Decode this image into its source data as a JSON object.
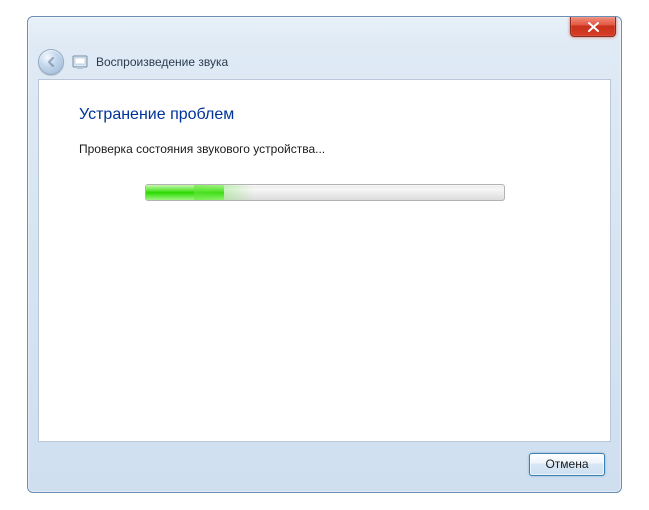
{
  "window": {
    "title": "Воспроизведение звука"
  },
  "content": {
    "heading": "Устранение проблем",
    "status": "Проверка состояния звукового устройства...",
    "progress_percent": 22
  },
  "footer": {
    "cancel_label": "Отмена"
  }
}
